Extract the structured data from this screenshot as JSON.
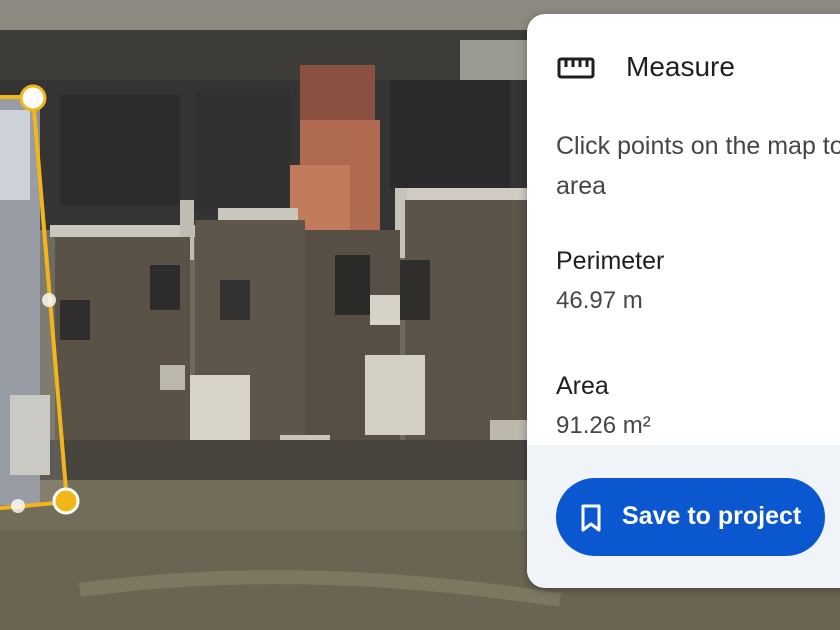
{
  "measure_panel": {
    "icon": "ruler-icon",
    "title": "Measure",
    "instructions": "Click points on the map to area",
    "perimeter": {
      "label": "Perimeter",
      "value": "46.97 m"
    },
    "area": {
      "label": "Area",
      "value": "91.26 m²"
    },
    "save_button": {
      "icon": "bookmark-icon",
      "label": "Save to project"
    }
  },
  "map": {
    "view": "satellite",
    "selection_color": "#f2b619"
  }
}
